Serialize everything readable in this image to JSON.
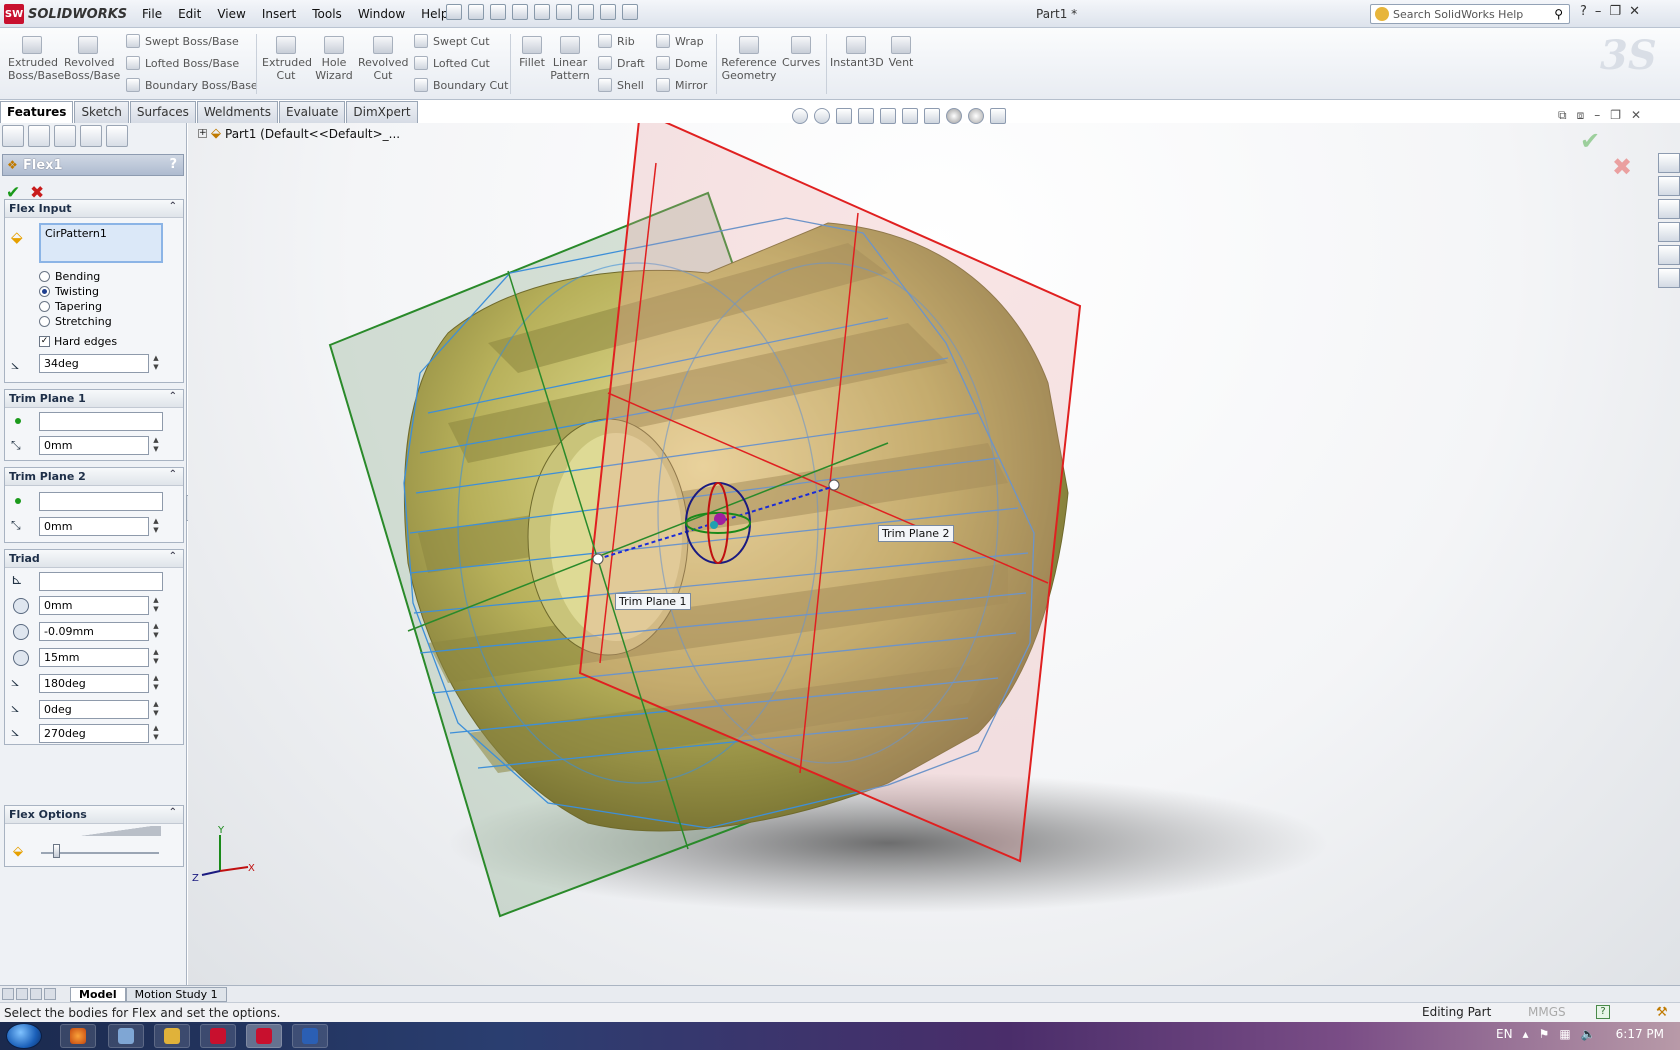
{
  "app": {
    "logo_text": "SOLIDWORKS",
    "doc_title": "Part1 *",
    "menu": [
      "File",
      "Edit",
      "View",
      "Insert",
      "Tools",
      "Window",
      "Help"
    ],
    "search_placeholder": "Search SolidWorks Help"
  },
  "commands": {
    "extruded_boss": "Extruded\nBoss/Base",
    "revolved_boss": "Revolved\nBoss/Base",
    "swept_boss": "Swept Boss/Base",
    "lofted_boss": "Lofted Boss/Base",
    "boundary_boss": "Boundary Boss/Base",
    "extruded_cut": "Extruded\nCut",
    "hole_wizard": "Hole\nWizard",
    "revolved_cut": "Revolved\nCut",
    "swept_cut": "Swept Cut",
    "lofted_cut": "Lofted Cut",
    "boundary_cut": "Boundary Cut",
    "fillet": "Fillet",
    "linear_pattern": "Linear\nPattern",
    "rib": "Rib",
    "draft": "Draft",
    "shell": "Shell",
    "wrap": "Wrap",
    "dome": "Dome",
    "mirror": "Mirror",
    "reference_geometry": "Reference\nGeometry",
    "curves": "Curves",
    "instant3d": "Instant3D",
    "vent": "Vent"
  },
  "tabs": [
    "Features",
    "Sketch",
    "Surfaces",
    "Weldments",
    "Evaluate",
    "DimXpert"
  ],
  "property_manager": {
    "title": "Flex1",
    "help": "?",
    "ok": "✔",
    "cancel": "✖",
    "flex_input": {
      "header": "Flex Input",
      "selection": "CirPattern1",
      "options": [
        {
          "label": "Bending",
          "selected": false
        },
        {
          "label": "Twisting",
          "selected": true
        },
        {
          "label": "Tapering",
          "selected": false
        },
        {
          "label": "Stretching",
          "selected": false
        }
      ],
      "hard_edges_label": "Hard edges",
      "hard_edges_checked": true,
      "angle": "34deg"
    },
    "trim_plane_1": {
      "header": "Trim Plane 1",
      "distance": "0mm"
    },
    "trim_plane_2": {
      "header": "Trim Plane 2",
      "distance": "0mm"
    },
    "triad": {
      "header": "Triad",
      "x": "0mm",
      "y": "-0.09mm",
      "z": "15mm",
      "rot_x": "180deg",
      "rot_y": "0deg",
      "rot_z": "270deg"
    },
    "flex_options": {
      "header": "Flex Options",
      "accuracy": 0.1
    }
  },
  "viewport": {
    "tree_item": "Part1  (Default<<Default>_...",
    "trim_plane_1_label": "Trim Plane 1",
    "trim_plane_2_label": "Trim Plane 2",
    "colors": {
      "gear": "#a6a04a",
      "flex_box": "#3d8fd8",
      "plane1": "#2a8a2a",
      "plane2": "#e02020"
    }
  },
  "bottom_tabs": [
    "Model",
    "Motion Study 1"
  ],
  "status": {
    "message": "Select the bodies for Flex and set the options.",
    "mode": "Editing Part",
    "units": "MMGS"
  },
  "taskbar": {
    "lang": "EN",
    "time": "6:17 PM"
  }
}
